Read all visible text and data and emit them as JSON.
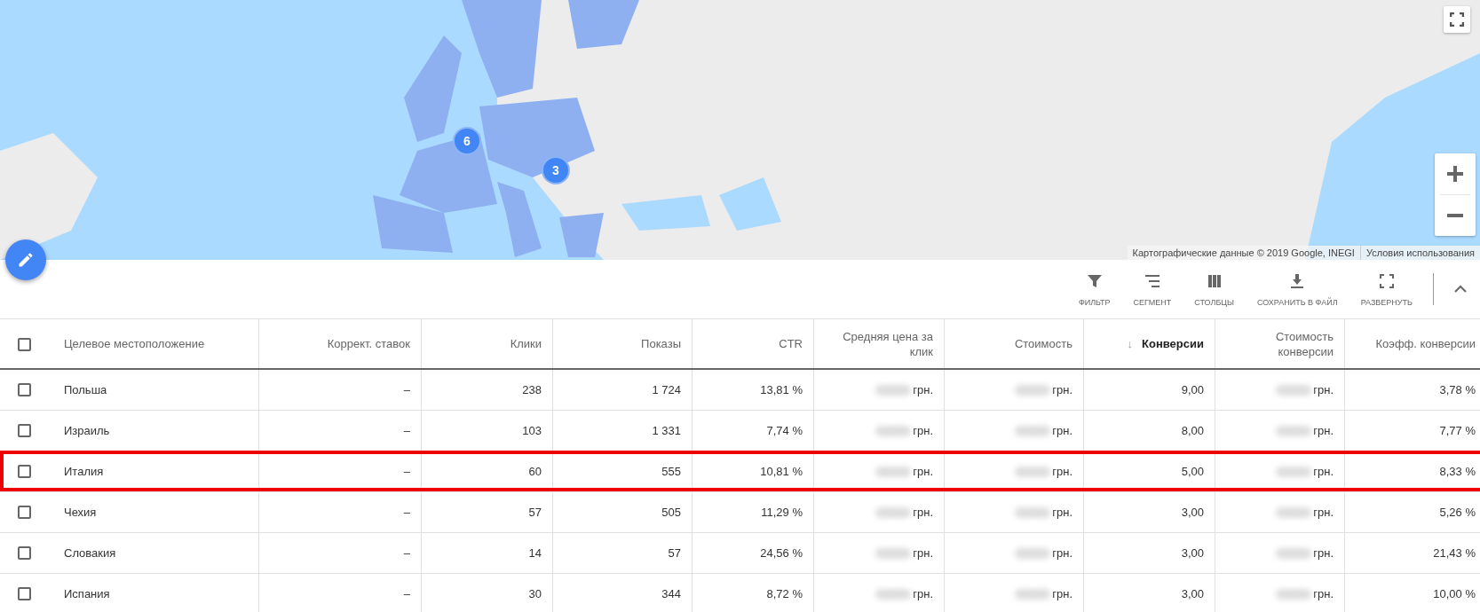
{
  "map": {
    "kind": "picture",
    "clusters": [
      {
        "count": "6"
      },
      {
        "count": "3"
      }
    ],
    "attribution": "Картографические данные © 2019 Google, INEGI",
    "terms_link": "Условия использования"
  },
  "toolbar": [
    {
      "label": "ФИЛЬТР",
      "kind": "filter"
    },
    {
      "label": "СЕГМЕНТ",
      "kind": "segment"
    },
    {
      "label": "СТОЛБЦЫ",
      "kind": "columns"
    },
    {
      "label": "СОХРАНИТЬ В ФАЙЛ",
      "kind": "download"
    },
    {
      "label": "РАЗВЕРНУТЬ",
      "kind": "expand"
    }
  ],
  "table": {
    "select_all_checked": false,
    "columns": [
      {
        "label": "Целевое местоположение",
        "sorted": false
      },
      {
        "label": "Коррект. ставок",
        "sorted": false
      },
      {
        "label": "Клики",
        "sorted": false
      },
      {
        "label": "Показы",
        "sorted": false
      },
      {
        "label": "CTR",
        "sorted": false
      },
      {
        "label": "Средняя цена за клик",
        "sorted": false
      },
      {
        "label": "Стоимость",
        "sorted": false
      },
      {
        "label": "Конверсии",
        "sorted": true,
        "sort_arrow": "↓"
      },
      {
        "label": "Стоимость конверсии",
        "sorted": false
      },
      {
        "label": "Коэфф. конверсии",
        "sorted": false
      }
    ],
    "rows": [
      {
        "checked": false,
        "highlighted": false,
        "cells": [
          "Польша",
          "–",
          "238",
          "1 724",
          "13,81 %",
          "грн.",
          "грн.",
          "9,00",
          "грн.",
          "3,78 %"
        ]
      },
      {
        "checked": false,
        "highlighted": false,
        "cells": [
          "Израиль",
          "–",
          "103",
          "1 331",
          "7,74 %",
          "грн.",
          "грн.",
          "8,00",
          "грн.",
          "7,77 %"
        ]
      },
      {
        "checked": false,
        "highlighted": true,
        "cells": [
          "Италия",
          "–",
          "60",
          "555",
          "10,81 %",
          "грн.",
          "грн.",
          "5,00",
          "грн.",
          "8,33 %"
        ]
      },
      {
        "checked": false,
        "highlighted": false,
        "cells": [
          "Чехия",
          "–",
          "57",
          "505",
          "11,29 %",
          "грн.",
          "грн.",
          "3,00",
          "грн.",
          "5,26 %"
        ]
      },
      {
        "checked": false,
        "highlighted": false,
        "cells": [
          "Словакия",
          "–",
          "14",
          "57",
          "24,56 %",
          "грн.",
          "грн.",
          "3,00",
          "грн.",
          "21,43 %"
        ]
      },
      {
        "checked": false,
        "highlighted": false,
        "cells": [
          "Испания",
          "–",
          "30",
          "344",
          "8,72 %",
          "грн.",
          "грн.",
          "3,00",
          "грн.",
          "10,00 %"
        ]
      }
    ]
  }
}
